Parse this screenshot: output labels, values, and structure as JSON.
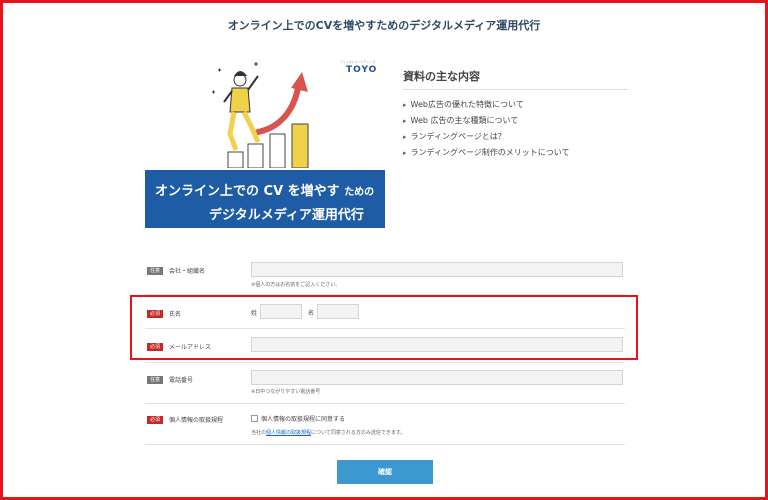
{
  "page": {
    "title": "オンライン上でのCVを増やすためのデジタルメディア運用代行"
  },
  "brand": {
    "name": "TOYO",
    "tagline": "ディジタルマーケティング"
  },
  "banner": {
    "line1_main": "オンライン上での CV を増やす",
    "line1_small": "ための",
    "line2": "デジタルメディア運用代行"
  },
  "contents": {
    "heading": "資料の主な内容",
    "items": [
      "Web広告の優れた特徴について",
      "Web 広告の主な種類について",
      "ランディングページとは？",
      "ランディングページ制作のメリットについて"
    ]
  },
  "form": {
    "company": {
      "badge": "任意",
      "label": "会社・組織名",
      "hint": "※個人の方はお名前をご記入ください。"
    },
    "name": {
      "badge": "必須",
      "label": "氏名",
      "last_label": "姓",
      "first_label": "名"
    },
    "email": {
      "badge": "必須",
      "label": "メールアドレス"
    },
    "phone": {
      "badge": "任意",
      "label": "電話番号",
      "hint": "※日中つながりやすい電話番号"
    },
    "privacy": {
      "badge": "必須",
      "label": "個人情報の取扱規程",
      "checkbox_label": "個人情報の取扱規程に同意する",
      "note_prefix": "当社の",
      "note_link": "個人情報の取扱規程",
      "note_suffix": "について同意される方のみ送信できます。"
    },
    "confirm_label": "確認"
  },
  "colors": {
    "accent_red": "#e5141a",
    "banner_blue": "#1f5ca6",
    "button_blue": "#3e98d0",
    "title_navy": "#2f4a66"
  }
}
